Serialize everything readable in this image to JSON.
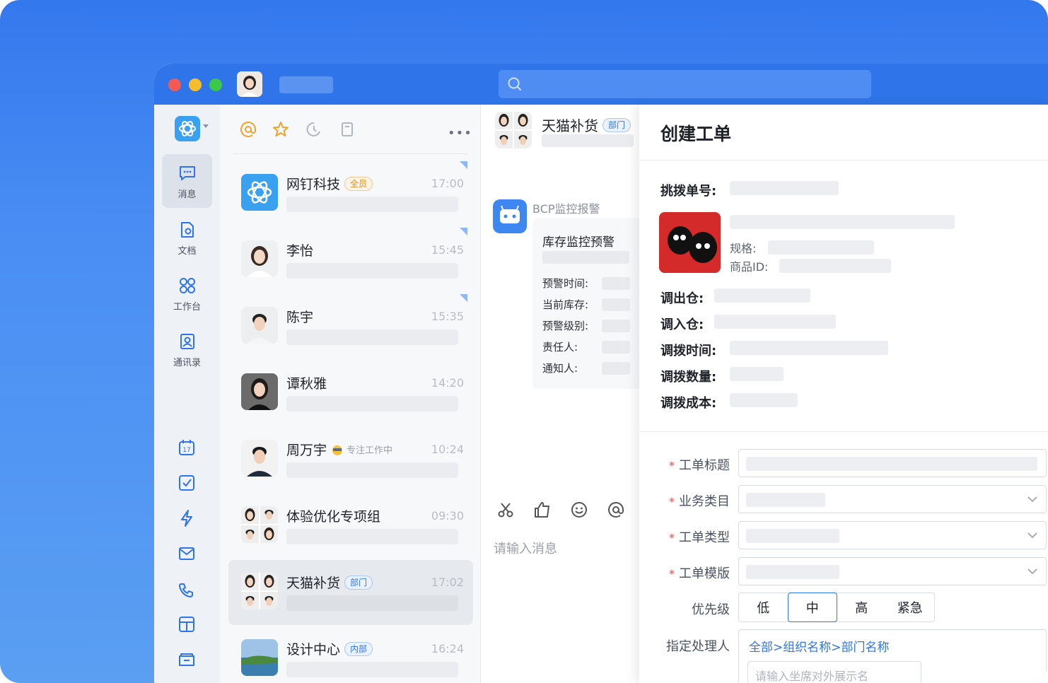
{
  "titlebar": {
    "search_placeholder": ""
  },
  "rail": {
    "items": [
      {
        "label": "消息"
      },
      {
        "label": "文档"
      },
      {
        "label": "工作台"
      },
      {
        "label": "通讯录"
      }
    ],
    "calendar_day": "17"
  },
  "conversations": [
    {
      "name": "网钉科技",
      "tag": "全员",
      "time": "17:00",
      "unread_marker": true
    },
    {
      "name": "李怡",
      "tag": "",
      "time": "15:45",
      "unread_marker": true
    },
    {
      "name": "陈宇",
      "tag": "",
      "time": "15:35",
      "unread_marker": true
    },
    {
      "name": "谭秋雅",
      "tag": "",
      "time": "14:20",
      "unread_marker": false
    },
    {
      "name": "周万宇",
      "status": "专注工作中",
      "time": "10:24",
      "unread_marker": false
    },
    {
      "name": "体验优化专项组",
      "tag": "",
      "time": "09:30",
      "unread_marker": false
    },
    {
      "name": "天猫补货",
      "tag": "部门",
      "time": "17:02",
      "unread_marker": false,
      "active": true
    },
    {
      "name": "设计中心",
      "tag": "内部",
      "time": "16:24",
      "unread_marker": false
    }
  ],
  "chat": {
    "title": "天猫补货",
    "tag": "部门",
    "bot_name": "BCP监控报警",
    "card": {
      "title": "库存监控预警",
      "rows": [
        "预警时间:",
        "当前库存:",
        "预警级别:",
        "责任人:",
        "通知人:"
      ]
    },
    "input_placeholder": "请输入消息"
  },
  "panel": {
    "title": "创建工单",
    "fields": {
      "transfer_no": "挑拨单号:",
      "spec": "规格:",
      "product_id": "商品ID:",
      "out_warehouse": "调出仓:",
      "in_warehouse": "调入仓:",
      "transfer_time": "调拨时间:",
      "transfer_qty": "调拨数量:",
      "transfer_cost": "调拨成本:"
    },
    "form": {
      "title_label": "工单标题",
      "category_label": "业务类目",
      "type_label": "工单类型",
      "template_label": "工单模版",
      "priority_label": "优先级",
      "priority_options": [
        "低",
        "中",
        "高",
        "紧急"
      ],
      "priority_selected": "中",
      "assignee_label": "指定处理人",
      "assignee_path": "全部>组织名称>部门名称",
      "assignee_placeholder": "请输入坐席对外展示名"
    }
  },
  "colors": {
    "accent": "#2f74e8",
    "background": "#3478ee",
    "required": "#e54545"
  }
}
